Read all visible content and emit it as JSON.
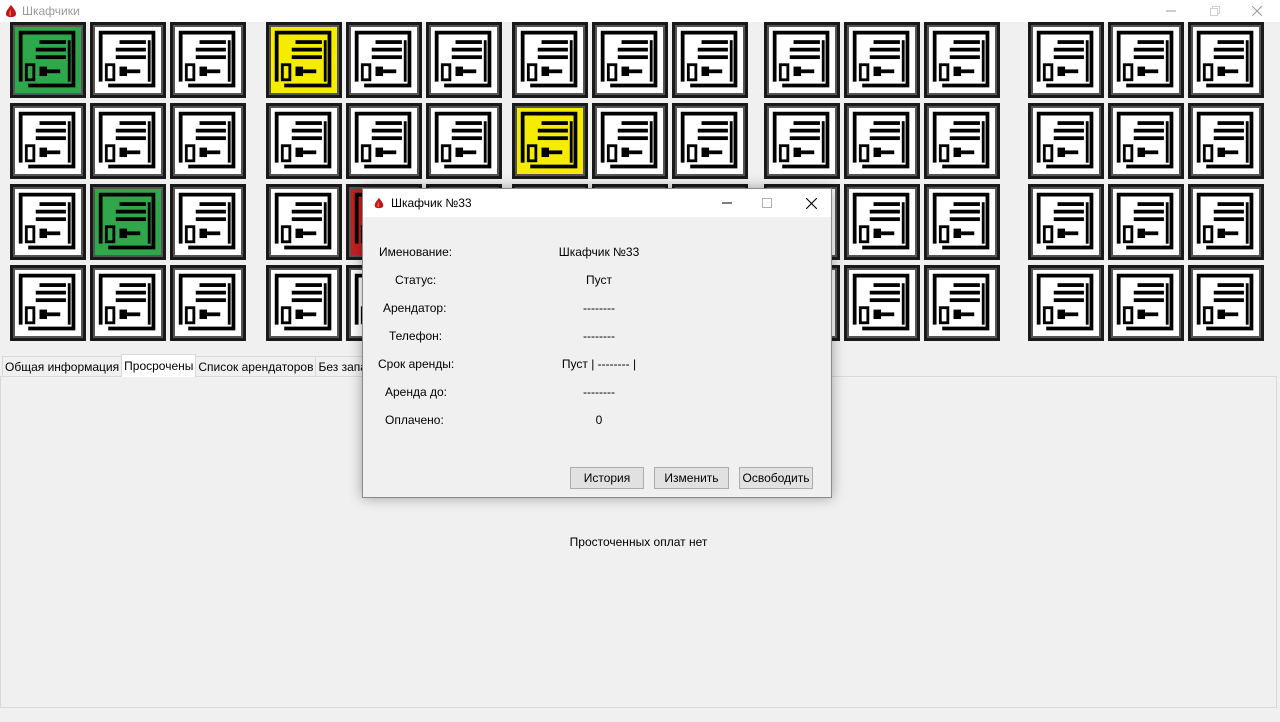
{
  "window": {
    "title": "Шкафчики"
  },
  "lockers": {
    "groups": [
      {
        "cells": [
          "green",
          "white",
          "white",
          "white",
          "white",
          "white",
          "white",
          "green",
          "white",
          "white",
          "white",
          "white"
        ]
      },
      {
        "cells": [
          "yellow",
          "white",
          "white",
          "white",
          "white",
          "white",
          "white",
          "red",
          "white",
          "white",
          "white",
          "white"
        ]
      },
      {
        "cells": [
          "white",
          "white",
          "white",
          "yellow",
          "white",
          "white",
          "white",
          "white",
          "white",
          "white",
          "white",
          "white"
        ]
      },
      {
        "cells": [
          "white",
          "white",
          "white",
          "white",
          "white",
          "white",
          "white",
          "white",
          "white",
          "white",
          "white",
          "white"
        ]
      },
      {
        "cells": [
          "white",
          "white",
          "white",
          "white",
          "white",
          "white",
          "white",
          "white",
          "white",
          "white",
          "white",
          "white"
        ]
      }
    ],
    "colors": {
      "green": "#2ea84a",
      "yellow": "#f6ec00",
      "red": "#c82020",
      "white": "#ffffff"
    }
  },
  "tabs": [
    {
      "label": "Общая информация",
      "active": false
    },
    {
      "label": "Просрочены",
      "active": true
    },
    {
      "label": "Список арендаторов",
      "active": false
    },
    {
      "label": "Без запасн",
      "active": false
    }
  ],
  "panel": {
    "message": "Просточенных оплат нет"
  },
  "dialog": {
    "title": "Шкафчик №33",
    "rows": [
      {
        "label": "Именование:",
        "value": "Шкафчик №33"
      },
      {
        "label": "Статус:",
        "value": "Пуст"
      },
      {
        "label": "Арендатор:",
        "value": "--------"
      },
      {
        "label": "Телефон:",
        "value": "--------"
      },
      {
        "label": "Срок аренды:",
        "value": "Пуст | -------- |"
      },
      {
        "label": "Аренда до:",
        "value": "--------"
      },
      {
        "label": "Оплачено:",
        "value": "0"
      }
    ],
    "buttons": {
      "history": "История",
      "edit": "Изменить",
      "release": "Освободить"
    }
  }
}
